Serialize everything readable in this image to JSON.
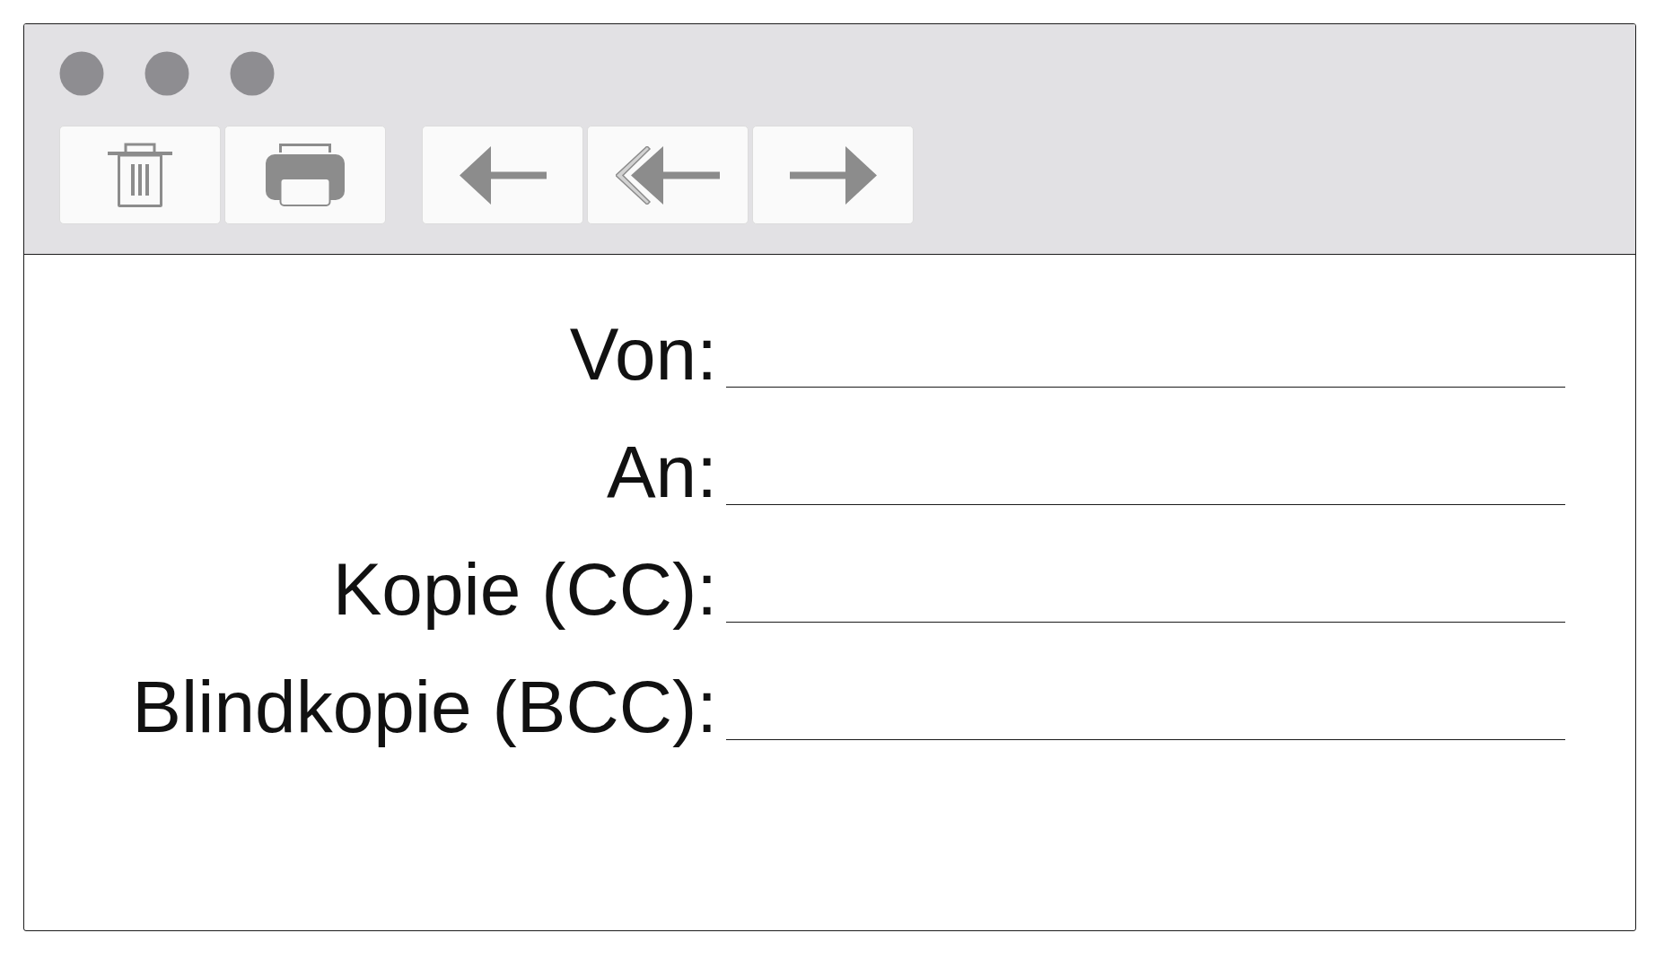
{
  "toolbar": {
    "groups": [
      {
        "buttons": [
          {
            "kind": "trash"
          },
          {
            "kind": "printer"
          }
        ]
      },
      {
        "buttons": [
          {
            "kind": "back"
          },
          {
            "kind": "back-all"
          },
          {
            "kind": "forward"
          }
        ]
      }
    ]
  },
  "fields": [
    {
      "label": "Von:"
    },
    {
      "label": "An:"
    },
    {
      "label": "Kopie (CC):"
    },
    {
      "label": "Blindkopie (BCC):"
    }
  ]
}
